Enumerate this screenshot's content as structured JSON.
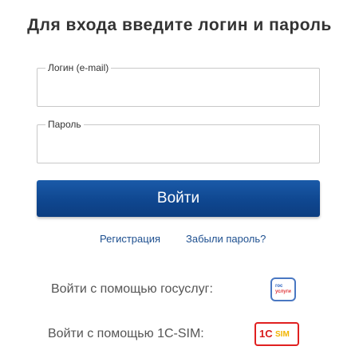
{
  "form": {
    "title": "Для входа введите логин и пароль",
    "login": {
      "label": "Логин (e-mail)",
      "value": "",
      "placeholder": ""
    },
    "password": {
      "label": "Пароль",
      "value": "",
      "placeholder": ""
    },
    "submit_label": "Войти"
  },
  "links": {
    "register": "Регистрация",
    "forgot_password": "Забыли пароль?"
  },
  "alt_login": {
    "gosuslugi": {
      "label": "Войти с помощью госуслуг:",
      "logo_top": "гос",
      "logo_bottom": "услуги"
    },
    "sim": {
      "label": "Войти с помощью 1C-SIM:",
      "logo_left": "1C",
      "logo_right": "SIM"
    }
  },
  "colors": {
    "button": "#0f4790",
    "link": "#1d4f8f",
    "gos_blue": "#2c63c0",
    "gos_red": "#e0363a",
    "sim_red": "#d81a1a",
    "sim_yellow": "#f2b400"
  },
  "icons": {
    "gosuslugi": "gosuslugi-logo-icon",
    "sim": "1c-sim-logo-icon"
  }
}
